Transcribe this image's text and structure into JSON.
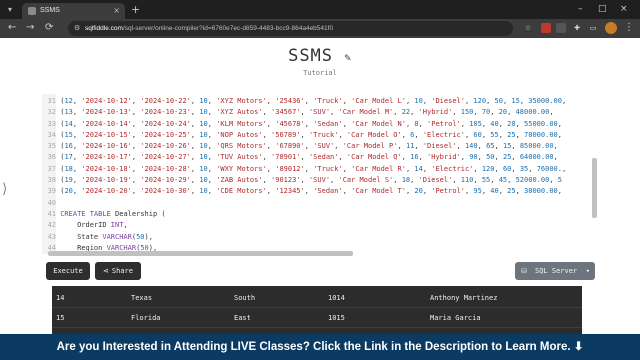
{
  "browser": {
    "tab_title": "SSMS",
    "tab_close": "×",
    "new_tab": "+",
    "url_prefix": "sqlfiddle.com",
    "url_rest": "/sql-server/online-compiler?id=6760e7ec-d859-4483-bcc9-864a4eb541f0",
    "window_controls": [
      "–",
      "□",
      "×"
    ],
    "nav": [
      "←",
      "→",
      "⟳"
    ],
    "icons": [
      "menu-icon",
      "favicon-icon",
      "back-icon",
      "forward-icon",
      "reload-icon",
      "site-info-icon",
      "extension-icon",
      "profile-avatar-icon",
      "kebab-menu-icon"
    ]
  },
  "app": {
    "title": "SSMS",
    "title_icon": "✎",
    "subtitle": "Tutorial"
  },
  "editor": {
    "lines": [
      {
        "no": "31",
        "text": "(12, '2024-10-12', '2024-10-22', 10, 'XYZ Motors', '25436', 'Truck', 'Car Model L', 10, 'Diesel', 120, 50, 15, 35000.00,"
      },
      {
        "no": "32",
        "text": "(13, '2024-10-13', '2024-10-23', 10, 'XYZ Autos', '34567', 'SUV', 'Car Model M', 22, 'Hybrid', 150, 70, 20, 48000.00,"
      },
      {
        "no": "33",
        "text": "(14, '2024-10-14', '2024-10-24', 10, 'KLM Motors', '45678', 'Sedan', 'Car Model N', 8, 'Petrol', 105, 40, 20, 55000.00,"
      },
      {
        "no": "34",
        "text": "(15, '2024-10-15', '2024-10-25', 10, 'NOP Autos', '56789', 'Truck', 'Car Model O', 6, 'Electric', 60, 55, 25, 70000.00,"
      },
      {
        "no": "35",
        "text": "(16, '2024-10-16', '2024-10-26', 10, 'QRS Motors', '67890', 'SUV', 'Car Model P', 11, 'Diesel', 140, 65, 15, 85000.00,"
      },
      {
        "no": "36",
        "text": "(17, '2024-10-17', '2024-10-27', 10, 'TUV Autos', '78901', 'Sedan', 'Car Model Q', 16, 'Hybrid', 90, 50, 25, 64000.00,"
      },
      {
        "no": "37",
        "text": "(18, '2024-10-18', '2024-10-28', 10, 'WXY Motors', '89012', 'Truck', 'Car Model R', 14, 'Electric', 120, 60, 35, 76000.,"
      },
      {
        "no": "38",
        "text": "(19, '2024-10-19', '2024-10-29', 10, 'ZAB Autos', '90123', 'SUV', 'Car Model S', 18, 'Diesel', 110, 55, 45, 52000.00, 5"
      },
      {
        "no": "39",
        "text": "(20, '2024-10-20', '2024-10-30', 10, 'CDE Motors', '12345', 'Sedan', 'Car Model T', 20, 'Petrol', 95, 40, 25, 30000.00,"
      },
      {
        "no": "40",
        "text": ""
      },
      {
        "no": "41",
        "text": "CREATE TABLE Dealership ("
      },
      {
        "no": "42",
        "text": "    OrderID INT,"
      },
      {
        "no": "43",
        "text": "    State VARCHAR(50),"
      },
      {
        "no": "44",
        "text": "    Region VARCHAR(50),"
      }
    ]
  },
  "actions": {
    "execute_label": "Execute",
    "share_label": "Share",
    "share_icon": "⋖",
    "dialect_label": "SQL Server",
    "dialect_icon": "⛁",
    "dialect_caret": "▾"
  },
  "results": {
    "rows": [
      [
        "14",
        "Texas",
        "South",
        "1014",
        "Anthony Martinez"
      ],
      [
        "15",
        "Florida",
        "East",
        "1015",
        "Maria Garcia"
      ],
      [
        "",
        "",
        "",
        "",
        ""
      ]
    ]
  },
  "banner": {
    "text": "Are you Interested in Attending LIVE Classes? Click the Link in the Description to Learn More. ⬇"
  },
  "colors": {
    "banner_bg": "#0b3a63",
    "results_bg": "#2c2c2c",
    "button_bg": "#2e2e2e",
    "dialect_bg": "#6c757d"
  }
}
